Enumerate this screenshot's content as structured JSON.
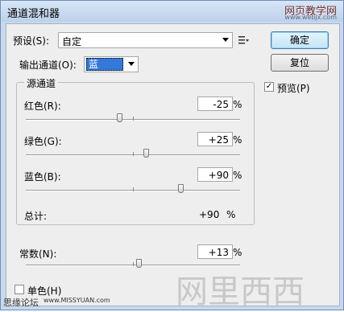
{
  "window": {
    "title": "通道混和器",
    "watermark_top": "网页教学网",
    "watermark_url": "www.webjx.com"
  },
  "preset": {
    "label": "预设(S):",
    "value": "自定"
  },
  "output": {
    "label": "输出通道(O):",
    "value": "蓝"
  },
  "buttons": {
    "ok": "确定",
    "reset": "复位"
  },
  "preview": {
    "label": "预览(P)",
    "checked": true
  },
  "source_group": {
    "title": "源通道"
  },
  "sliders": [
    {
      "label": "红色(R):",
      "value": "-25",
      "unit": "%",
      "percent": -25
    },
    {
      "label": "绿色(G):",
      "value": "+25",
      "unit": "%",
      "percent": 25
    },
    {
      "label": "蓝色(B):",
      "value": "+90",
      "unit": "%",
      "percent": 90
    }
  ],
  "total": {
    "label": "总计:",
    "value": "+90",
    "unit": "%"
  },
  "constant": {
    "label": "常数(N):",
    "value": "+13",
    "unit": "%",
    "percent": 13
  },
  "mono": {
    "label": "单色(H)",
    "checked": false
  },
  "footer": {
    "left": "思缘论坛",
    "url": "www.MISSYUAN.com",
    "logo": "网里西西"
  },
  "colors": {
    "title_bg": "#c9d8ec",
    "dialog_bg": "#eeeeee",
    "default_button": "#3c7fb1",
    "output_highlight": "#3478d8"
  },
  "icons": {
    "preset_menu": "list-menu-icon",
    "dropdown": "chevron-down-icon"
  }
}
